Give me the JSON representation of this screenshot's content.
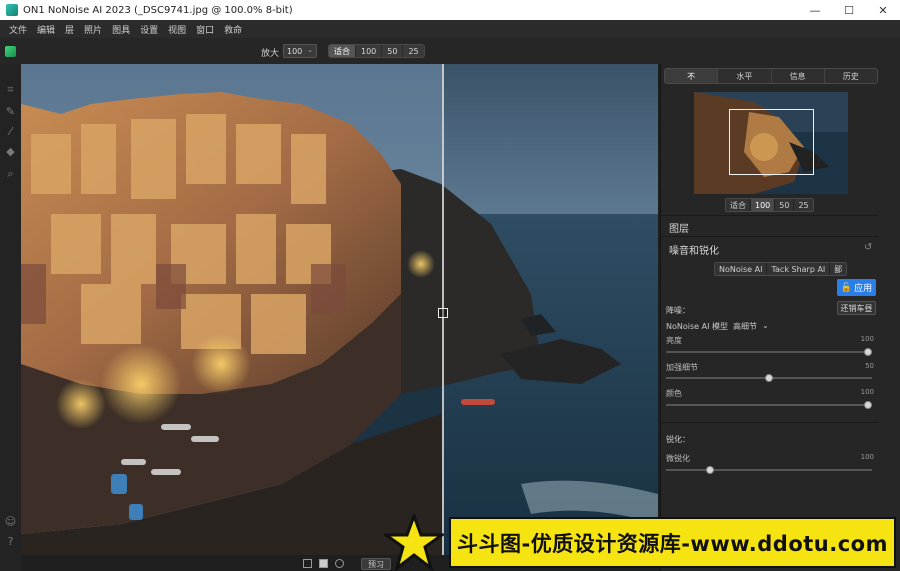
{
  "window": {
    "title": "ON1 NoNoise AI 2023 (_DSC9741.jpg @ 100.0% 8-bit)",
    "controls": [
      "—",
      "☐",
      "✕"
    ]
  },
  "menu": {
    "items": [
      "文件",
      "编辑",
      "层",
      "照片",
      "图具",
      "设置",
      "视图",
      "窗口",
      "救命"
    ]
  },
  "toolbar": {
    "zoom_label": "放大",
    "zoom_value": "100",
    "zoom_presets": [
      "适合",
      "100",
      "50",
      "25"
    ]
  },
  "right_panel": {
    "tabs": [
      "不",
      "水平",
      "信息",
      "历史"
    ],
    "active_tab": 0,
    "nav_zoom_presets": [
      "适合",
      "100",
      "50",
      "25"
    ],
    "layers_title": "图层",
    "module_title": "噪音和锐化",
    "engine_tabs": [
      "NoNoise AI",
      "Tack Sharp AI"
    ],
    "engine_tab_extra": "鄙",
    "apply_label": "应用",
    "undo_label": "还销车昼",
    "denoise_group": "降噪：",
    "model_label": "NoNoise AI 模型",
    "model_value": "高细节",
    "sliders": [
      {
        "label": "亮度",
        "value": "100",
        "fraction": 1.0
      },
      {
        "label": "加强细节",
        "value": "50",
        "fraction": 0.5
      },
      {
        "label": "颜色",
        "value": "100",
        "fraction": 1.0
      }
    ],
    "sharpen_group": "锐化：",
    "sharpen_slider": {
      "label": "微锐化",
      "value": "100",
      "fraction": 0.2
    }
  },
  "bottom": {
    "preview_label": "预习"
  },
  "watermark": {
    "text": "斗斗图-优质设计资源库-www.ddotu.com"
  },
  "colors": {
    "accent": "#2a7ee8",
    "panel_bg": "#262626",
    "watermark_bg": "#f6e312"
  }
}
